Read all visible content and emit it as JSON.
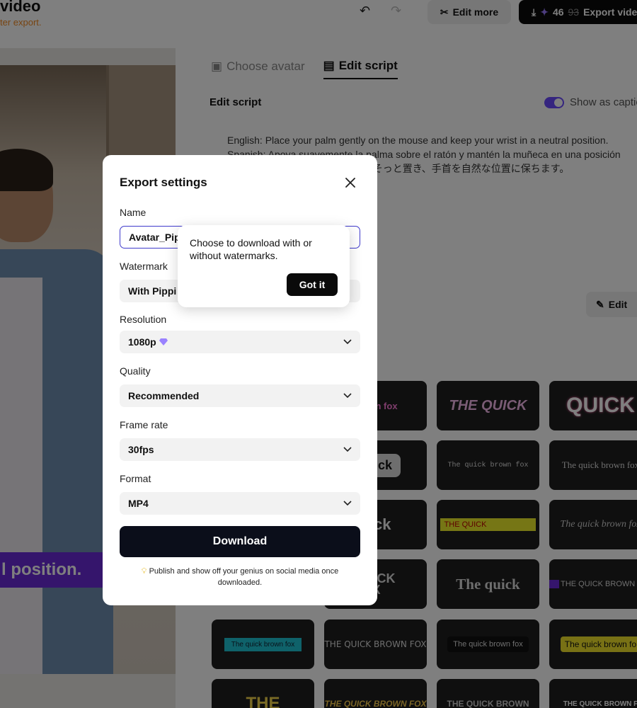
{
  "header": {
    "title": "video",
    "subtitle": "ter export.",
    "edit_more_label": "Edit more",
    "export_credits": "46",
    "export_credits_old": "93",
    "export_label": "Export vide"
  },
  "tabs": [
    {
      "label": "Choose avatar",
      "active": false
    },
    {
      "label": "Edit script",
      "active": true
    }
  ],
  "script": {
    "heading": "Edit script",
    "toggle_label": "Show as captio",
    "line1": "English: Place your palm gently on the mouse and keep your wrist in a neutral position.",
    "line2": "Spanish: Apoya suavemente la palma sobre el ratón y mantén la muñeca en una posición",
    "line3": "マウスにそっと置き、手首を自然な位置に保ちます。",
    "edit_label": "Edit"
  },
  "video": {
    "caption": "l position."
  },
  "styles": [
    {
      "text": "brown fox"
    },
    {
      "text": "THE QUICK"
    },
    {
      "text": "QUICK"
    },
    {
      "text": "quick"
    },
    {
      "text": "The quick brown fox"
    },
    {
      "text": "The quick brown fox"
    },
    {
      "text": "uick"
    },
    {
      "text": "THE QUICK"
    },
    {
      "text": "The quick brown fox"
    },
    {
      "text": "QUICK FOX"
    },
    {
      "text": "The quick"
    },
    {
      "text": "THE QUICK BROWN FOX"
    },
    {
      "text": "The quick brown fox"
    },
    {
      "text": "THE QUICK BROWN FOX"
    },
    {
      "text": "The quick brown fox"
    },
    {
      "text": "The quick brown fo"
    },
    {
      "text": "THE"
    },
    {
      "text": "THE QUICK BROWN FOX"
    },
    {
      "text": "THE QUICK BROWN"
    },
    {
      "text": "THE QUICK BROWN F"
    }
  ],
  "modal": {
    "title": "Export settings",
    "name_label": "Name",
    "name_value": "Avatar_Pip",
    "watermark_label": "Watermark",
    "watermark_value": "With Pippi",
    "resolution_label": "Resolution",
    "resolution_value": "1080p",
    "quality_label": "Quality",
    "quality_value": "Recommended",
    "framerate_label": "Frame rate",
    "framerate_value": "30fps",
    "format_label": "Format",
    "format_value": "MP4",
    "download_label": "Download",
    "hint": "Publish and show off your genius on social media once downloaded."
  },
  "popover": {
    "text": "Choose to download with or without watermarks.",
    "button": "Got it"
  }
}
